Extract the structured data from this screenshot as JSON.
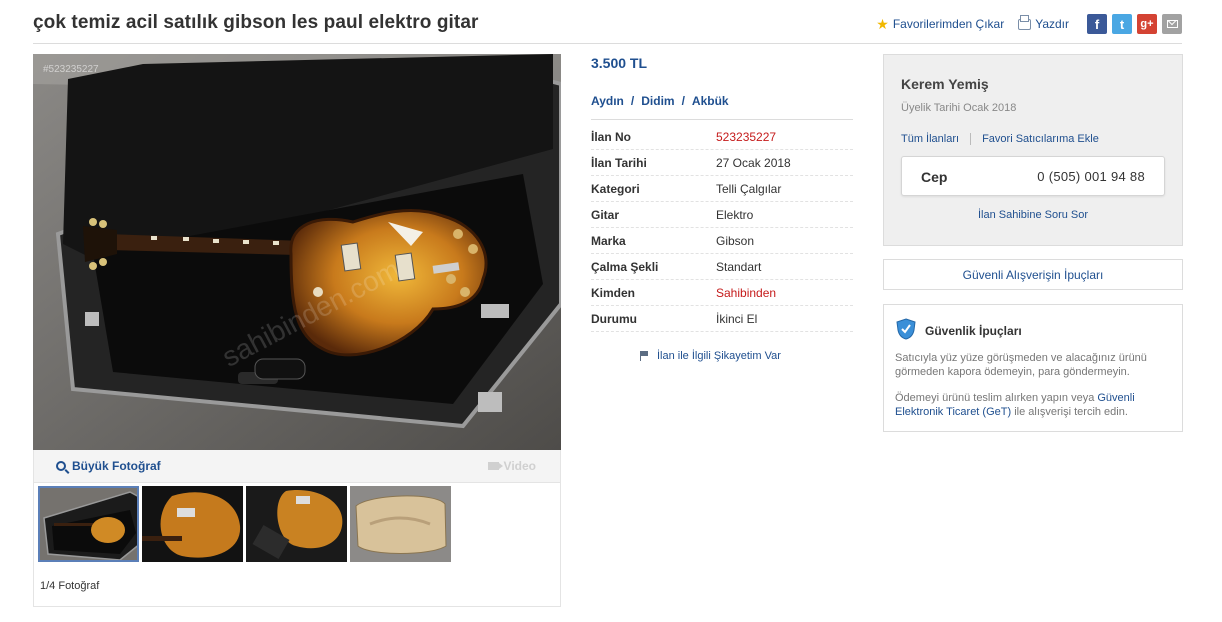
{
  "listing": {
    "title": "çok temiz acil satılık gibson les paul elektro gitar",
    "price": "3.500 TL",
    "location": [
      "Aydın",
      "Didim",
      "Akbük"
    ],
    "location_sep": "/",
    "photo_id": "#523235227",
    "watermark": "sahibinden.com",
    "info": [
      {
        "label": "İlan No",
        "value": "523235227",
        "highlight": true
      },
      {
        "label": "İlan Tarihi",
        "value": "27 Ocak 2018",
        "highlight": false
      },
      {
        "label": "Kategori",
        "value": "Telli Çalgılar",
        "highlight": false
      },
      {
        "label": "Gitar",
        "value": "Elektro",
        "highlight": false
      },
      {
        "label": "Marka",
        "value": "Gibson",
        "highlight": false
      },
      {
        "label": "Çalma Şekli",
        "value": "Standart",
        "highlight": false
      },
      {
        "label": "Kimden",
        "value": "Sahibinden",
        "highlight": true
      },
      {
        "label": "Durumu",
        "value": "İkinci El",
        "highlight": false
      }
    ],
    "complaint": "İlan ile İlgili Şikayetim Var"
  },
  "header": {
    "favorite": "Favorilerimden Çıkar",
    "print": "Yazdır",
    "social": {
      "facebook": "f",
      "twitter": "t",
      "googleplus": "g+"
    }
  },
  "gallery": {
    "big_photo": "Büyük Fotoğraf",
    "video": "Video",
    "count": "1/4 Fotoğraf"
  },
  "seller": {
    "name": "Kerem Yemiş",
    "member_since": "Üyelik Tarihi  Ocak 2018",
    "all_listings": "Tüm İlanları",
    "add_favorite": "Favori Satıcılarıma Ekle",
    "phone_label": "Cep",
    "phone": "0 (505) 001 94 88",
    "ask": "İlan Sahibine Soru Sor"
  },
  "safe_shopping": "Güvenli Alışverişin İpuçları",
  "security": {
    "title": "Güvenlik İpuçları",
    "text1": "Satıcıyla yüz yüze görüşmeden ve alacağınız ürünü görmeden kapora ödemeyin, para göndermeyin.",
    "text2_before": "Ödemeyi ürünü teslim alırken yapın veya ",
    "text2_link": "Güvenli Elektronik Ticaret (GeT)",
    "text2_after": " ile alışverişi tercih edin."
  },
  "colors": {
    "link": "#1f4f8f",
    "highlight": "#c51b1b",
    "star": "#f1b800",
    "facebook": "#3b5998",
    "twitter": "#4aa7e3",
    "googleplus": "#d44333"
  }
}
